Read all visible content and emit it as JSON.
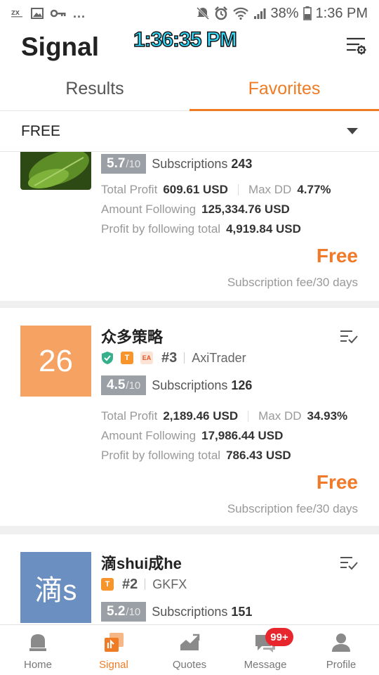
{
  "status_bar": {
    "battery": "38%",
    "time": "1:36 PM",
    "left_icons": [
      "app-logo-icon",
      "image-icon",
      "key-icon"
    ],
    "more": "...",
    "right_icons": [
      "mute-icon",
      "alarm-icon",
      "wifi-icon",
      "signal-icon",
      "battery-icon"
    ]
  },
  "header": {
    "title": "Signal",
    "clock_overlay": "1:36:35 PM",
    "filter_icon": "filter-settings-icon"
  },
  "tabs": [
    {
      "label": "Results",
      "active": false
    },
    {
      "label": "Favorites",
      "active": true
    }
  ],
  "filter": {
    "selected": "FREE",
    "icon": "dropdown-caret-icon"
  },
  "colors": {
    "accent": "#ef7b24",
    "price": "#f07a2a",
    "badge_red": "#e8262d",
    "score_bg": "#9aa0a6"
  },
  "cards": [
    {
      "avatar_text": "",
      "avatar_color": "#3f6b1f",
      "score": "5.7",
      "score_max": "/10",
      "subscriptions_label": "Subscriptions",
      "subscriptions": "243",
      "total_profit_label": "Total Profit",
      "total_profit": "609.61 USD",
      "max_dd_label": "Max DD",
      "max_dd": "4.77%",
      "amount_following_label": "Amount Following",
      "amount_following": "125,334.76 USD",
      "profit_following_label": "Profit by following total",
      "profit_following": "4,919.84 USD",
      "price": "Free",
      "fee_note": "Subscription fee/30 days"
    },
    {
      "avatar_text": "26",
      "avatar_color": "#f5a262",
      "name": "众多策略",
      "badges": [
        "shield-check-icon",
        "T",
        "EA"
      ],
      "rank": "#3",
      "broker": "AxiTrader",
      "score": "4.5",
      "score_max": "/10",
      "subscriptions_label": "Subscriptions",
      "subscriptions": "126",
      "total_profit_label": "Total Profit",
      "total_profit": "2,189.46 USD",
      "max_dd_label": "Max DD",
      "max_dd": "34.93%",
      "amount_following_label": "Amount Following",
      "amount_following": "17,986.44 USD",
      "profit_following_label": "Profit by following total",
      "profit_following": "786.43 USD",
      "price": "Free",
      "fee_note": "Subscription fee/30 days"
    },
    {
      "avatar_text": "滴s",
      "avatar_color": "#6b8fc1",
      "name": "滴shui成he",
      "badges": [
        "T"
      ],
      "rank": "#2",
      "broker": "GKFX",
      "score": "5.2",
      "score_max": "/10",
      "subscriptions_label": "Subscriptions",
      "subscriptions": "151"
    }
  ],
  "bottom_nav": [
    {
      "label": "Home",
      "icon": "home-icon",
      "active": false
    },
    {
      "label": "Signal",
      "icon": "signal-app-icon",
      "active": true
    },
    {
      "label": "Quotes",
      "icon": "chart-trend-icon",
      "active": false
    },
    {
      "label": "Message",
      "icon": "chat-icon",
      "active": false,
      "badge": "99+"
    },
    {
      "label": "Profile",
      "icon": "person-icon",
      "active": false
    }
  ]
}
